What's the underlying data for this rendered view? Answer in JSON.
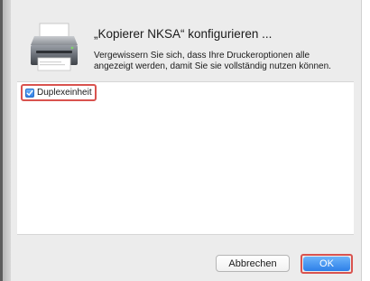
{
  "dialog": {
    "title": "„Kopierer NKSA“ konfigurieren ...",
    "message": "Vergewissern Sie sich, dass Ihre Druckeroptionen alle angezeigt werden, damit Sie sie vollständig nutzen können."
  },
  "options": [
    {
      "label": "Duplexeinheit",
      "checked": true
    }
  ],
  "buttons": {
    "cancel_label": "Abbrechen",
    "ok_label": "OK"
  },
  "icons": {
    "printer": "printer-icon",
    "checkmark": "checkmark-icon"
  },
  "colors": {
    "accent_blue": "#2d7fe8",
    "highlight_red": "#d9534f",
    "sheet_background": "#ececec"
  }
}
